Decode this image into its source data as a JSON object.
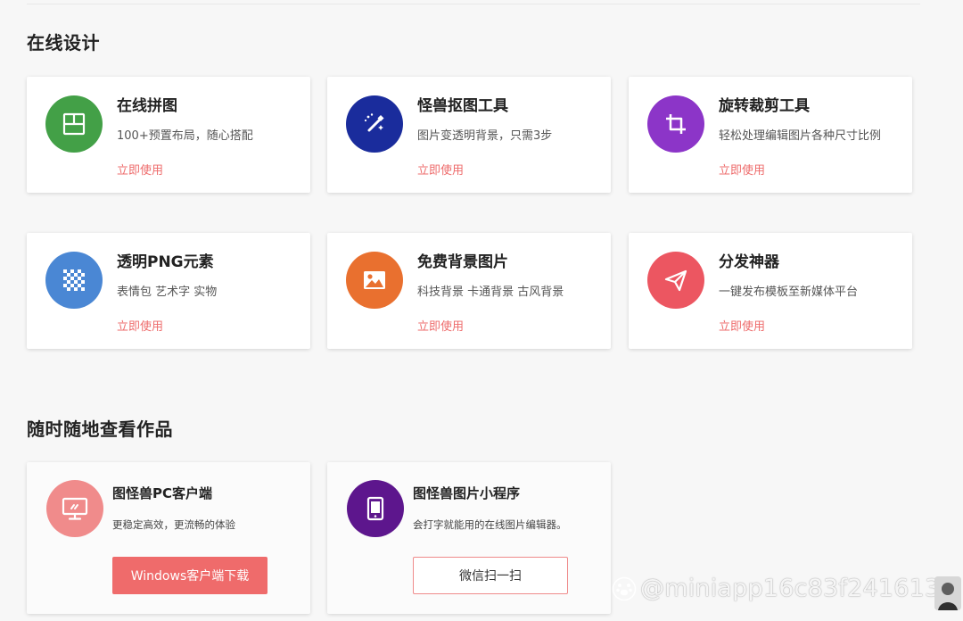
{
  "online_design": {
    "title": "在线设计",
    "tools": [
      {
        "title": "在线拼图",
        "description": "100+预置布局，随心搭配",
        "link": "立即使用",
        "icon": "collage-layout-icon",
        "color": "#43a047"
      },
      {
        "title": "怪兽抠图工具",
        "description": "图片变透明背景，只需3步",
        "link": "立即使用",
        "icon": "magic-wand-icon",
        "color": "#1a2c9c"
      },
      {
        "title": "旋转裁剪工具",
        "description": "轻松处理编辑图片各种尺寸比例",
        "link": "立即使用",
        "icon": "crop-icon",
        "color": "#8c35c8"
      },
      {
        "title": "透明PNG元素",
        "description": "表情包  艺术字  实物",
        "link": "立即使用",
        "icon": "checkerboard-icon",
        "color": "#4a87d4"
      },
      {
        "title": "免费背景图片",
        "description": "科技背景  卡通背景  古风背景",
        "link": "立即使用",
        "icon": "image-icon",
        "color": "#e9702f"
      },
      {
        "title": "分发神器",
        "description": "一键发布模板至新媒体平台",
        "link": "立即使用",
        "icon": "paper-plane-icon",
        "color": "#ec5661"
      }
    ]
  },
  "anytime_view": {
    "title": "随时随地查看作品",
    "clients": [
      {
        "title": "图怪兽PC客户端",
        "description": "更稳定高效，更流畅的体验",
        "button": "Windows客户端下载",
        "icon": "monitor-icon",
        "color": "#f08b8b"
      },
      {
        "title": "图怪兽图片小程序",
        "description": "会打字就能用的在线图片编辑器。",
        "button": "微信扫一扫",
        "icon": "tablet-icon",
        "color": "#5d168d"
      }
    ]
  },
  "watermark": {
    "text": "@miniapp16c83f241613",
    "logo_icon": "paw-logo-icon"
  }
}
